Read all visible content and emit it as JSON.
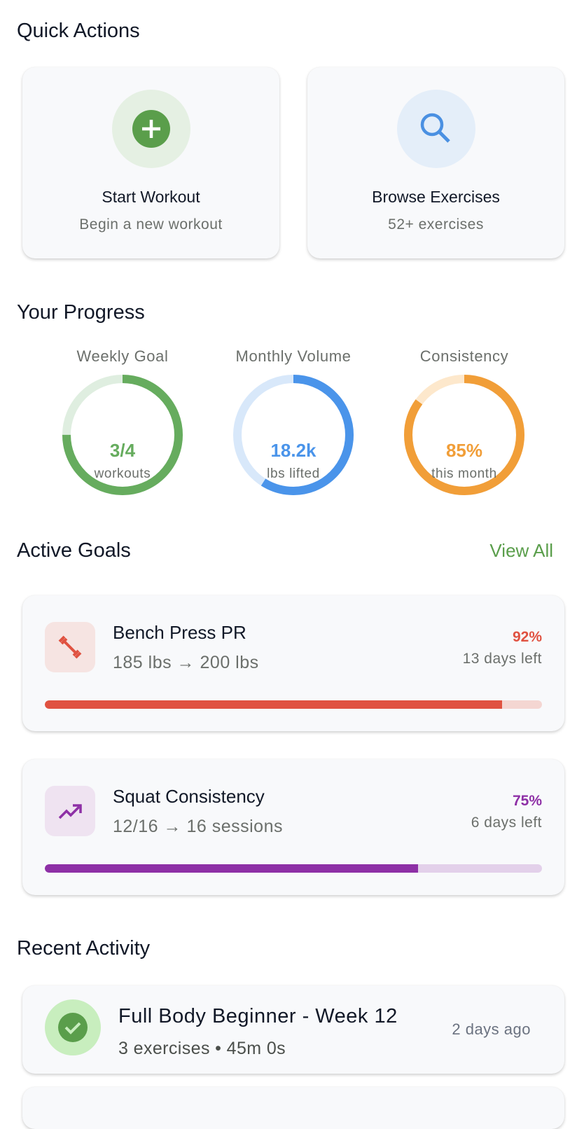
{
  "quick_actions": {
    "title": "Quick Actions",
    "items": [
      {
        "title": "Start Workout",
        "subtitle": "Begin a new workout",
        "icon": "plus-circle-icon",
        "color": "#5a9e4b"
      },
      {
        "title": "Browse Exercises",
        "subtitle": "52+ exercises",
        "icon": "search-icon",
        "color": "#4a90e2"
      }
    ]
  },
  "progress": {
    "title": "Your Progress",
    "rings": [
      {
        "label": "Weekly Goal",
        "value": "3/4",
        "sub": "workouts",
        "fraction": 0.75,
        "color": "#66ac5e",
        "track": "#dfeee0"
      },
      {
        "label": "Monthly Volume",
        "value": "18.2k",
        "sub": "lbs lifted",
        "fraction": 0.59,
        "color": "#4a94ea",
        "track": "#d8e8fa"
      },
      {
        "label": "Consistency",
        "value": "85%",
        "sub": "this month",
        "fraction": 0.85,
        "color": "#f19e38",
        "track": "#fde8cc"
      }
    ]
  },
  "goals": {
    "title": "Active Goals",
    "view_all": "View All",
    "items": [
      {
        "name": "Bench Press PR",
        "detail": "185 lbs → 200 lbs",
        "percent": "92%",
        "progress": 92,
        "days_left": "13 days left",
        "icon": "dumbbell-icon",
        "color": "#e05241",
        "bg": "#f6e4e2",
        "track": "#f4d6d2"
      },
      {
        "name": "Squat Consistency",
        "detail": "12/16 → 16 sessions",
        "percent": "75%",
        "progress": 75,
        "days_left": "6 days left",
        "icon": "trending-up-icon",
        "color": "#8e30a6",
        "bg": "#efe3f1",
        "track": "#e3d0ea"
      }
    ]
  },
  "activity": {
    "title": "Recent Activity",
    "items": [
      {
        "title": "Full Body Beginner - Week 12",
        "meta": "3 exercises • 45m 0s",
        "time": "2 days ago",
        "icon": "check-circle-icon"
      }
    ]
  }
}
